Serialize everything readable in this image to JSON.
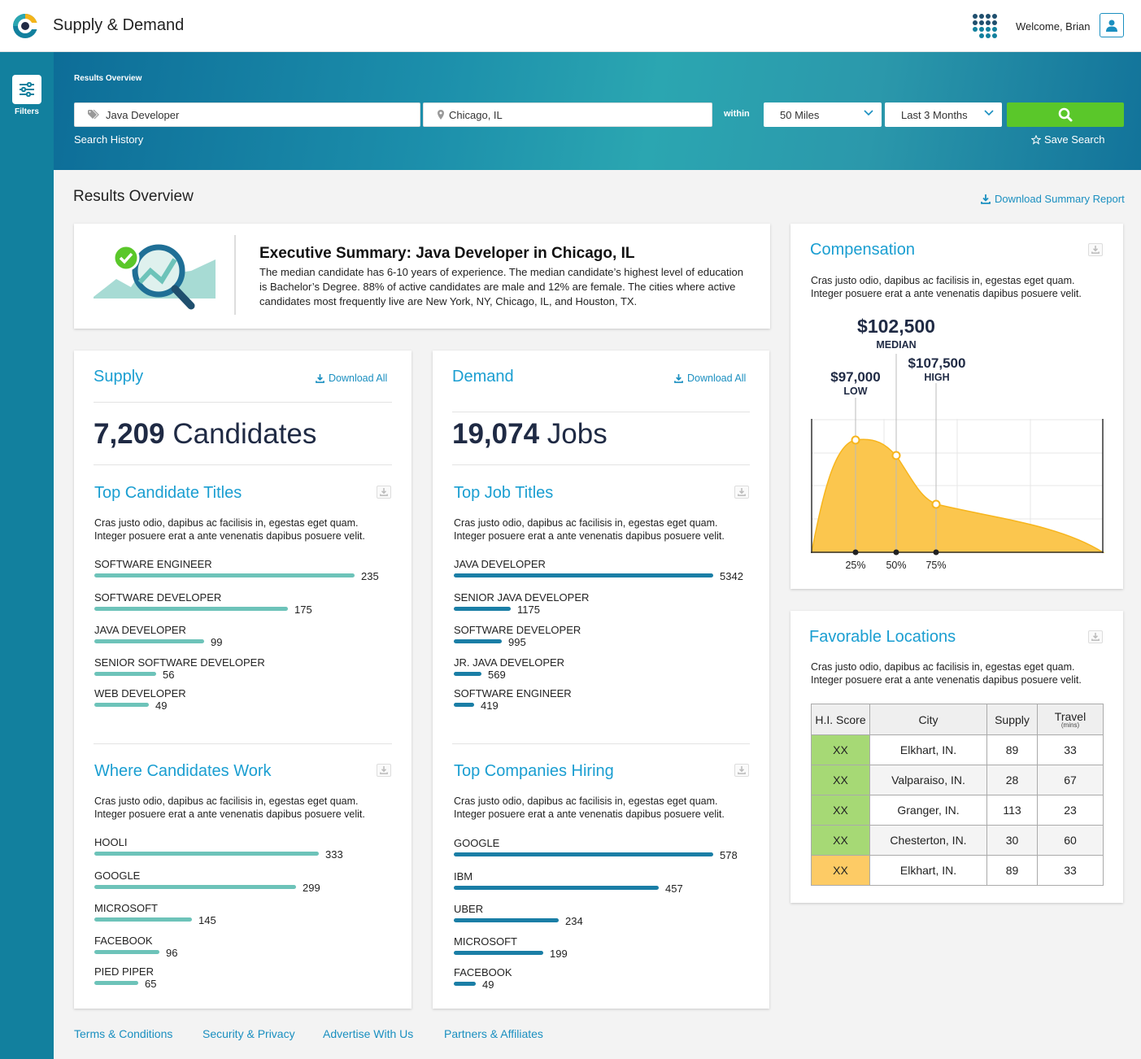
{
  "app": {
    "title": "Supply & Demand",
    "welcome": "Welcome, Brian"
  },
  "sidebar": {
    "filters_label": "Filters"
  },
  "hero": {
    "title": "Results Overview",
    "keyword_value": "Java Developer",
    "location_value": "Chicago, IL",
    "within_label": "within",
    "distance_value": "50 Miles",
    "range_value": "Last 3 Months",
    "search_history_label": "Search History",
    "save_search_label": "Save Search"
  },
  "overview": {
    "title": "Results Overview",
    "download_report_label": "Download Summary Report"
  },
  "executive_summary": {
    "title": "Executive Summary: Java Developer in Chicago, IL",
    "body": "The median candidate has 6-10 years of experience. The median candidate’s highest level of education is Bachelor’s Degree. 88% of active candidates are male and 12% are female. The cities where active candidates most frequently live are New York, NY, Chicago, IL, and Houston, TX."
  },
  "lorem": "Cras justo odio, dapibus ac facilisis in, egestas eget quam. Integer posuere erat a ante venenatis dapibus posuere velit.",
  "supply": {
    "title": "Supply",
    "download_label": "Download All",
    "count": "7,209",
    "unit": "Candidates",
    "bar_color": "#6dc3b9",
    "top_titles": {
      "title": "Top Candidate Titles",
      "max": 235,
      "items": [
        {
          "label": "SOFTWARE ENGINEER",
          "value": 235
        },
        {
          "label": "SOFTWARE DEVELOPER",
          "value": 175
        },
        {
          "label": "JAVA DEVELOPER",
          "value": 99
        },
        {
          "label": "SENIOR SOFTWARE DEVELOPER",
          "value": 56
        },
        {
          "label": "WEB DEVELOPER",
          "value": 49
        }
      ]
    },
    "where_work": {
      "title": "Where Candidates Work",
      "max": 333,
      "items": [
        {
          "label": "HOOLI",
          "value": 333
        },
        {
          "label": "GOOGLE",
          "value": 299
        },
        {
          "label": "MICROSOFT",
          "value": 145
        },
        {
          "label": "FACEBOOK",
          "value": 96
        },
        {
          "label": "PIED PIPER",
          "value": 65
        }
      ]
    }
  },
  "demand": {
    "title": "Demand",
    "download_label": "Download All",
    "count": "19,074",
    "unit": "Jobs",
    "bar_color": "#1a7ea6",
    "top_titles": {
      "title": "Top Job Titles",
      "max": 5342,
      "items": [
        {
          "label": "JAVA DEVELOPER",
          "value": 5342
        },
        {
          "label": "SENIOR JAVA DEVELOPER",
          "value": 1175
        },
        {
          "label": "SOFTWARE DEVELOPER",
          "value": 995
        },
        {
          "label": "JR. JAVA DEVELOPER",
          "value": 569
        },
        {
          "label": "SOFTWARE ENGINEER",
          "value": 419
        }
      ]
    },
    "companies": {
      "title": "Top Companies Hiring",
      "max": 578,
      "items": [
        {
          "label": "GOOGLE",
          "value": 578
        },
        {
          "label": "IBM",
          "value": 457
        },
        {
          "label": "UBER",
          "value": 234
        },
        {
          "label": "MICROSOFT",
          "value": 199
        },
        {
          "label": "FACEBOOK",
          "value": 49
        }
      ]
    }
  },
  "compensation": {
    "title": "Compensation",
    "median_value": "$102,500",
    "median_label": "MEDIAN",
    "low_value": "$97,000",
    "low_label": "LOW",
    "high_value": "$107,500",
    "high_label": "HIGH",
    "tick_25": "25%",
    "tick_50": "50%",
    "tick_75": "75%",
    "fill_color": "#fbc64e"
  },
  "locations": {
    "title": "Favorable Locations",
    "headers": {
      "score": "H.I. Score",
      "city": "City",
      "supply": "Supply",
      "travel": "Travel",
      "travel_unit": "(mins)"
    },
    "rows": [
      {
        "score": "XX",
        "city": "Elkhart, IN.",
        "supply": "89",
        "travel": "33",
        "color": "#a6d975"
      },
      {
        "score": "XX",
        "city": "Valparaiso, IN.",
        "supply": "28",
        "travel": "67",
        "color": "#a6d975"
      },
      {
        "score": "XX",
        "city": "Granger, IN.",
        "supply": "113",
        "travel": "23",
        "color": "#a6d975"
      },
      {
        "score": "XX",
        "city": "Chesterton, IN.",
        "supply": "30",
        "travel": "60",
        "color": "#a6d975"
      },
      {
        "score": "XX",
        "city": "Elkhart, IN.",
        "supply": "89",
        "travel": "33",
        "color": "#fdcb65"
      }
    ]
  },
  "footer": {
    "links": [
      "Terms & Conditions",
      "Security & Privacy",
      "Advertise With Us",
      "Partners & Affiliates"
    ]
  }
}
